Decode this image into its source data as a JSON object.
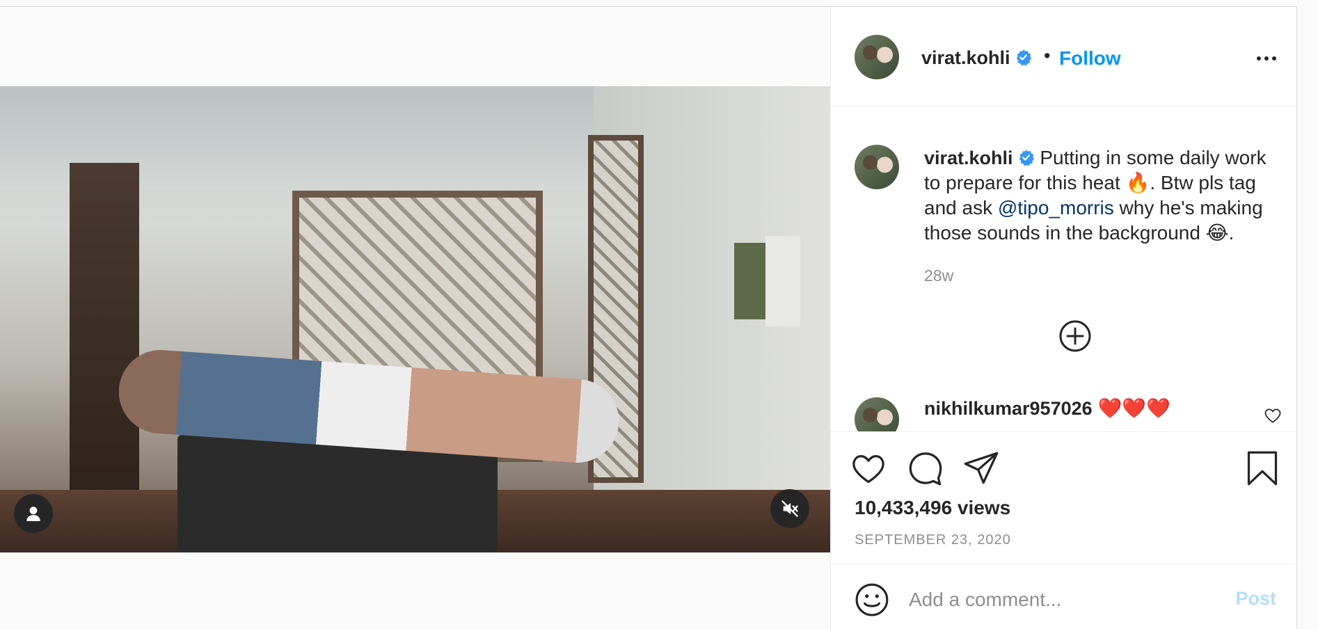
{
  "post": {
    "author": "virat.kohli",
    "follow_label": "Follow",
    "dot": "•",
    "caption_text_1": "Putting in some daily work to prepare for this heat 🔥. Btw pls tag and ask ",
    "caption_mention": "@tipo_morris",
    "caption_text_2": " why he's making those sounds in the background 😂.",
    "time": "28w",
    "views": "10,433,496 views",
    "date": "SEPTEMBER 23, 2020"
  },
  "comments": [
    {
      "username": "nikhilkumar957026",
      "text": "❤️❤️❤️"
    }
  ],
  "add_comment": {
    "placeholder": "Add a comment...",
    "post_label": "Post"
  },
  "colors": {
    "accent": "#0095f6",
    "verified": "#3897f0",
    "post_disabled": "#b2dffc",
    "mention": "#00376b"
  },
  "icons": [
    "user-tag-icon",
    "muted-speaker-icon",
    "verified-badge-icon",
    "more-options-icon",
    "load-more-comments-icon",
    "heart-icon",
    "comment-icon",
    "share-icon",
    "bookmark-icon",
    "emoji-icon"
  ]
}
